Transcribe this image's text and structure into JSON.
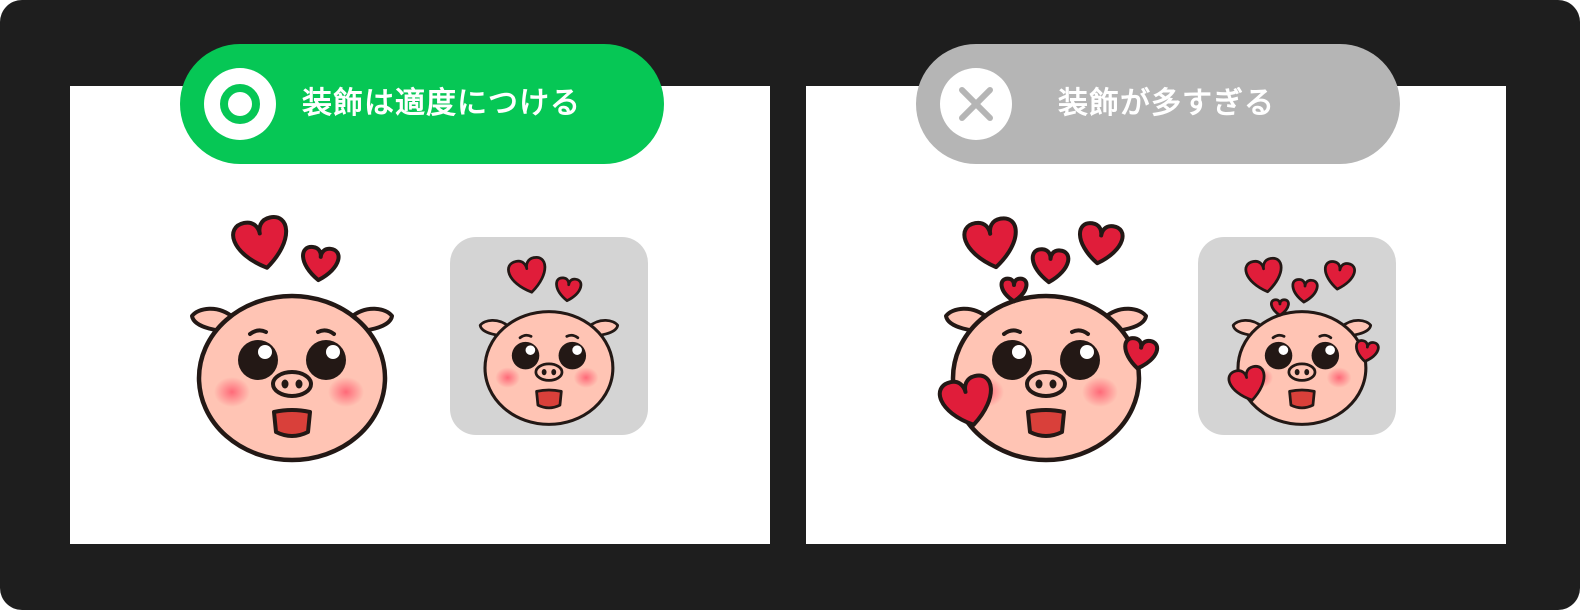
{
  "good_example": {
    "label": "装飾は適度につける",
    "icon": "circle-icon",
    "accent_color": "#06c755"
  },
  "bad_example": {
    "label": "装飾が多すぎる",
    "icon": "cross-icon",
    "accent_color": "#b5b5b5"
  },
  "colors": {
    "frame": "#1e1e1e",
    "panel": "#ffffff",
    "thumbnail_bg": "#d4d4d4",
    "heart": "#e01d3a",
    "pig_skin": "#ffc4b4",
    "outline": "#231815"
  }
}
